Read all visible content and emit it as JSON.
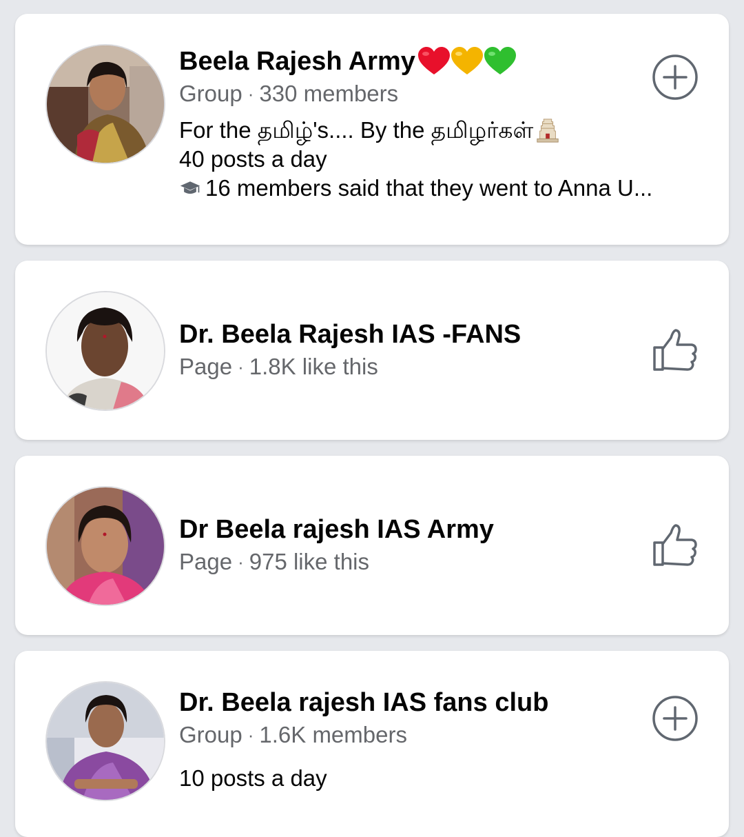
{
  "results": [
    {
      "name": "Beela Rajesh Army",
      "emoji": [
        "red-heart",
        "yellow-heart",
        "green-heart"
      ],
      "type": "Group",
      "stat": "330 members",
      "description": "For the தமிழ்'s.... By the தமிழர்கள்",
      "activity": "40 posts a day",
      "education_note": "16 members said that they went to Anna U...",
      "action_icon": "plus-circle-icon"
    },
    {
      "name": "Dr. Beela Rajesh IAS -FANS",
      "type": "Page",
      "stat": "1.8K like this",
      "action_icon": "like-thumb-icon"
    },
    {
      "name": "Dr Beela rajesh IAS Army",
      "type": "Page",
      "stat": "975 like this",
      "action_icon": "like-thumb-icon"
    },
    {
      "name": "Dr. Beela rajesh IAS fans club",
      "type": "Group",
      "stat": "1.6K members",
      "activity": "10 posts a day",
      "action_icon": "plus-circle-icon"
    }
  ],
  "meta_separator": "·",
  "colors": {
    "background": "#e6e8ec",
    "card": "#ffffff",
    "title": "#050505",
    "secondary": "#65676b",
    "icon": "#606770"
  }
}
